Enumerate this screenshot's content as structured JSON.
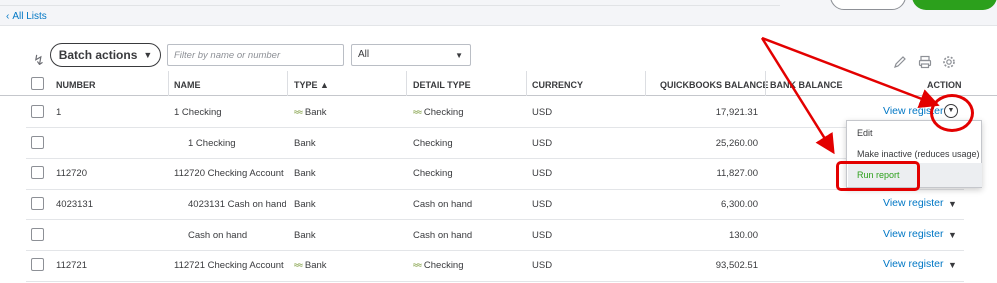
{
  "nav": {
    "back_label": "All Lists"
  },
  "toolbar": {
    "batch_label": "Batch actions",
    "filter_placeholder": "Filter by name or number",
    "type_selected": "All"
  },
  "columns": {
    "number": "NUMBER",
    "name": "NAME",
    "type": "TYPE ▲",
    "detail_type": "DETAIL TYPE",
    "currency": "CURRENCY",
    "qb_balance": "QUICKBOOKS BALANCE",
    "bank_balance": "BANK BALANCE",
    "action": "ACTION"
  },
  "rows": [
    {
      "number": "1",
      "name": "1 Checking",
      "type": "Bank",
      "detail_type": "Checking",
      "currency": "USD",
      "qb_balance": "17,921.31",
      "action": "View register"
    },
    {
      "number": "",
      "name": "1 Checking",
      "type": "Bank",
      "detail_type": "Checking",
      "currency": "USD",
      "qb_balance": "25,260.00",
      "action": ""
    },
    {
      "number": "112720",
      "name": "112720 Checking Account -",
      "type": "Bank",
      "detail_type": "Checking",
      "currency": "USD",
      "qb_balance": "11,827.00",
      "action": ""
    },
    {
      "number": "4023131",
      "name": "4023131 Cash on hand (",
      "type": "Bank",
      "detail_type": "Cash on hand",
      "currency": "USD",
      "qb_balance": "6,300.00",
      "action": "View register"
    },
    {
      "number": "",
      "name": "Cash on hand",
      "type": "Bank",
      "detail_type": "Cash on hand",
      "currency": "USD",
      "qb_balance": "130.00",
      "action": "View register"
    },
    {
      "number": "112721",
      "name": "112721 Checking Account -",
      "type": "Bank",
      "detail_type": "Checking",
      "currency": "USD",
      "qb_balance": "93,502.51",
      "action": "View register"
    }
  ],
  "action_menu": {
    "edit": "Edit",
    "make_inactive": "Make inactive (reduces usage)",
    "run_report": "Run report"
  },
  "icons": [
    "pencil-icon",
    "printer-icon",
    "gear-icon",
    "sort-arrow-icon",
    "bank-account-icon",
    "chevron-left-icon",
    "caret-down-icon"
  ],
  "colors": {
    "link": "#0077c5",
    "accent_green": "#2ca01c",
    "annotation_red": "#e30000"
  }
}
